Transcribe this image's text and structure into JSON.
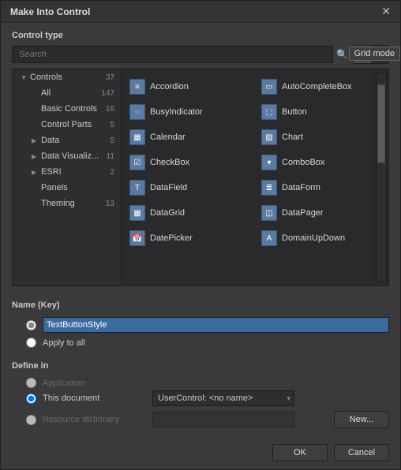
{
  "dialog": {
    "title": "Make Into Control",
    "section_control_type": "Control type",
    "search_placeholder": "Search",
    "tooltip_grid": "Grid mode",
    "section_name": "Name (Key)",
    "name_value": "TextButtonStyle",
    "apply_all": "Apply to all",
    "section_define": "Define in",
    "opt_application": "Application",
    "opt_this_document": "This document",
    "opt_resource_dict": "Resource dictionary",
    "combo_value": "UserControl: <no name>",
    "btn_new": "New...",
    "btn_ok": "OK",
    "btn_cancel": "Cancel"
  },
  "tree": [
    {
      "label": "Controls",
      "count": "37",
      "arrow": "▼",
      "indent": 0
    },
    {
      "label": "All",
      "count": "147",
      "arrow": "",
      "indent": 1
    },
    {
      "label": "Basic Controls",
      "count": "16",
      "arrow": "",
      "indent": 1
    },
    {
      "label": "Control Parts",
      "count": "5",
      "arrow": "",
      "indent": 1
    },
    {
      "label": "Data",
      "count": "5",
      "arrow": "▶",
      "indent": 1
    },
    {
      "label": "Data Visualiz...",
      "count": "11",
      "arrow": "▶",
      "indent": 1
    },
    {
      "label": "ESRI",
      "count": "2",
      "arrow": "▶",
      "indent": 1
    },
    {
      "label": "Panels",
      "count": "",
      "arrow": "",
      "indent": 1
    },
    {
      "label": "Theming",
      "count": "13",
      "arrow": "",
      "indent": 1
    }
  ],
  "controls": [
    {
      "name": "Accordion",
      "glyph": "≡"
    },
    {
      "name": "AutoCompleteBox",
      "glyph": "▭"
    },
    {
      "name": "BusyIndicator",
      "glyph": "◌"
    },
    {
      "name": "Button",
      "glyph": "⬚"
    },
    {
      "name": "Calendar",
      "glyph": "▦"
    },
    {
      "name": "Chart",
      "glyph": "▧"
    },
    {
      "name": "CheckBox",
      "glyph": "☑"
    },
    {
      "name": "ComboBox",
      "glyph": "▾"
    },
    {
      "name": "DataField",
      "glyph": "T"
    },
    {
      "name": "DataForm",
      "glyph": "≣"
    },
    {
      "name": "DataGrid",
      "glyph": "▦"
    },
    {
      "name": "DataPager",
      "glyph": "◫"
    },
    {
      "name": "DatePicker",
      "glyph": "📅"
    },
    {
      "name": "DomainUpDown",
      "glyph": "A"
    }
  ]
}
